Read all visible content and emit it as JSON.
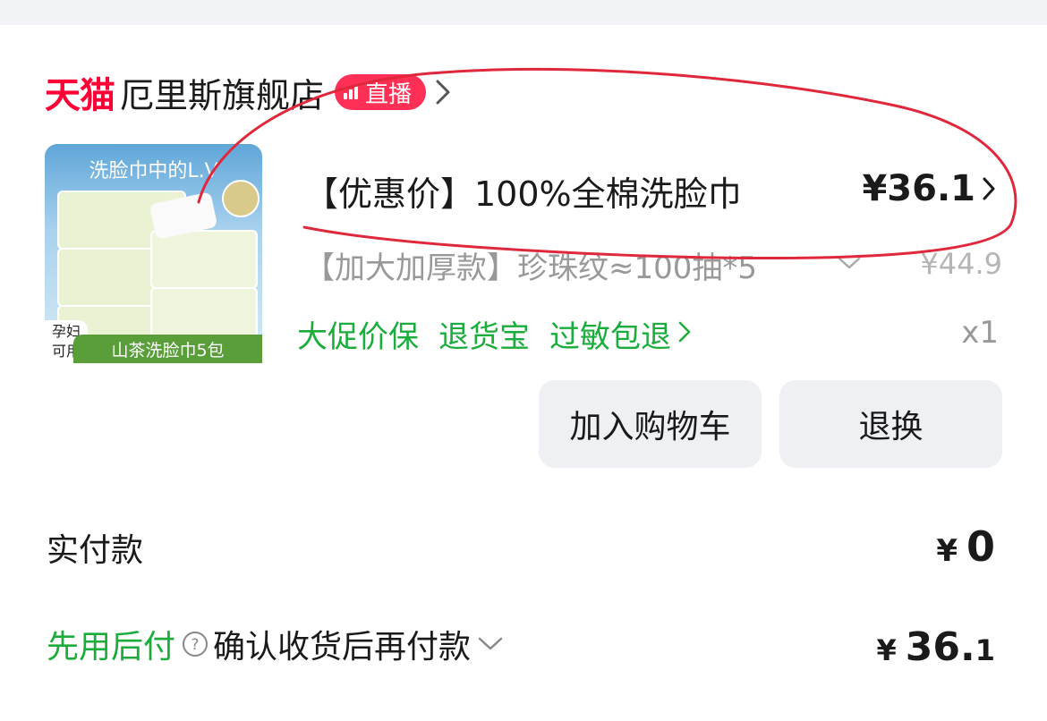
{
  "store": {
    "platform_logo": "天猫",
    "name": "厄里斯旗舰店",
    "live_badge": "直播",
    "accent_color": "#ff0036"
  },
  "product": {
    "thumbnail": {
      "title": "洗脸巾中的L.V",
      "bottom_label": "山茶洗脸巾5包",
      "corner_tag": "孕妇\n可用"
    },
    "title": "【优惠价】100%全棉洗脸巾",
    "price": "¥36.1",
    "sku": "【加大加厚款】珍珠纹≈100抽*5",
    "original_price": "¥44.9",
    "guarantees": [
      "大促价保",
      "退货宝",
      "过敏包退"
    ],
    "quantity": "x1"
  },
  "actions": {
    "add_to_cart": "加入购物车",
    "return_exchange": "退换"
  },
  "payment": {
    "paid_label": "实付款",
    "paid_symbol": "¥",
    "paid_amount": "0",
    "later_label": "先用后付",
    "later_description": "确认收货后再付款",
    "later_symbol": "¥",
    "later_amount_int": "36.",
    "later_amount_dec": "1"
  },
  "colors": {
    "green": "#1aad3b",
    "annotation_red": "#e0283c",
    "muted_text": "#999999",
    "button_bg": "#eef0f4"
  }
}
